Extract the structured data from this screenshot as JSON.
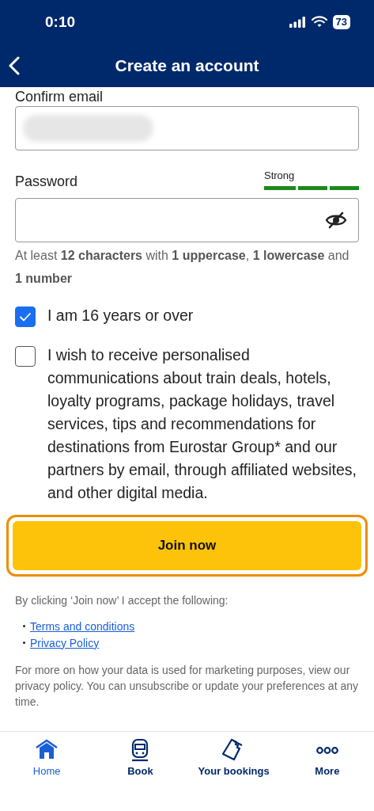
{
  "status_bar": {
    "time": "0:10",
    "battery": "73"
  },
  "header": {
    "title": "Create an account"
  },
  "confirm_email": {
    "label": "Confirm email",
    "value_redacted": true
  },
  "password": {
    "label": "Password",
    "strength": {
      "label": "Strong",
      "level": 1
    },
    "hint": "At least **12 characters** with **1 uppercase**, **1 lowercase** and **1 number**"
  },
  "checkboxes": [
    {
      "label": "I am 16 years or over",
      "checked": true
    },
    {
      "label": "I wish to receive personalised communications about train deals, hotels, loyalty programs, package holidays, travel services, tips and recommendations for destinations from Eurostar Group* and our partners by email, through affiliated websites, and other digital media.",
      "checked": false
    }
  ],
  "submit": {
    "label": "Join now",
    "focused": true
  },
  "consent": {
    "intro": "By clicking ‘Join now’ I accept the following:",
    "links": [
      "Terms and conditions",
      "Privacy Policy"
    ],
    "note": "For more on how your data is used for marketing purposes, view our privacy policy. You can unsubscribe or update your preferences at any time."
  },
  "tab_bar": [
    {
      "label": "Home",
      "selected": true
    },
    {
      "label": "Book",
      "selected": false
    },
    {
      "label": "Your bookings",
      "selected": false
    },
    {
      "label": "More",
      "selected": false
    }
  ]
}
